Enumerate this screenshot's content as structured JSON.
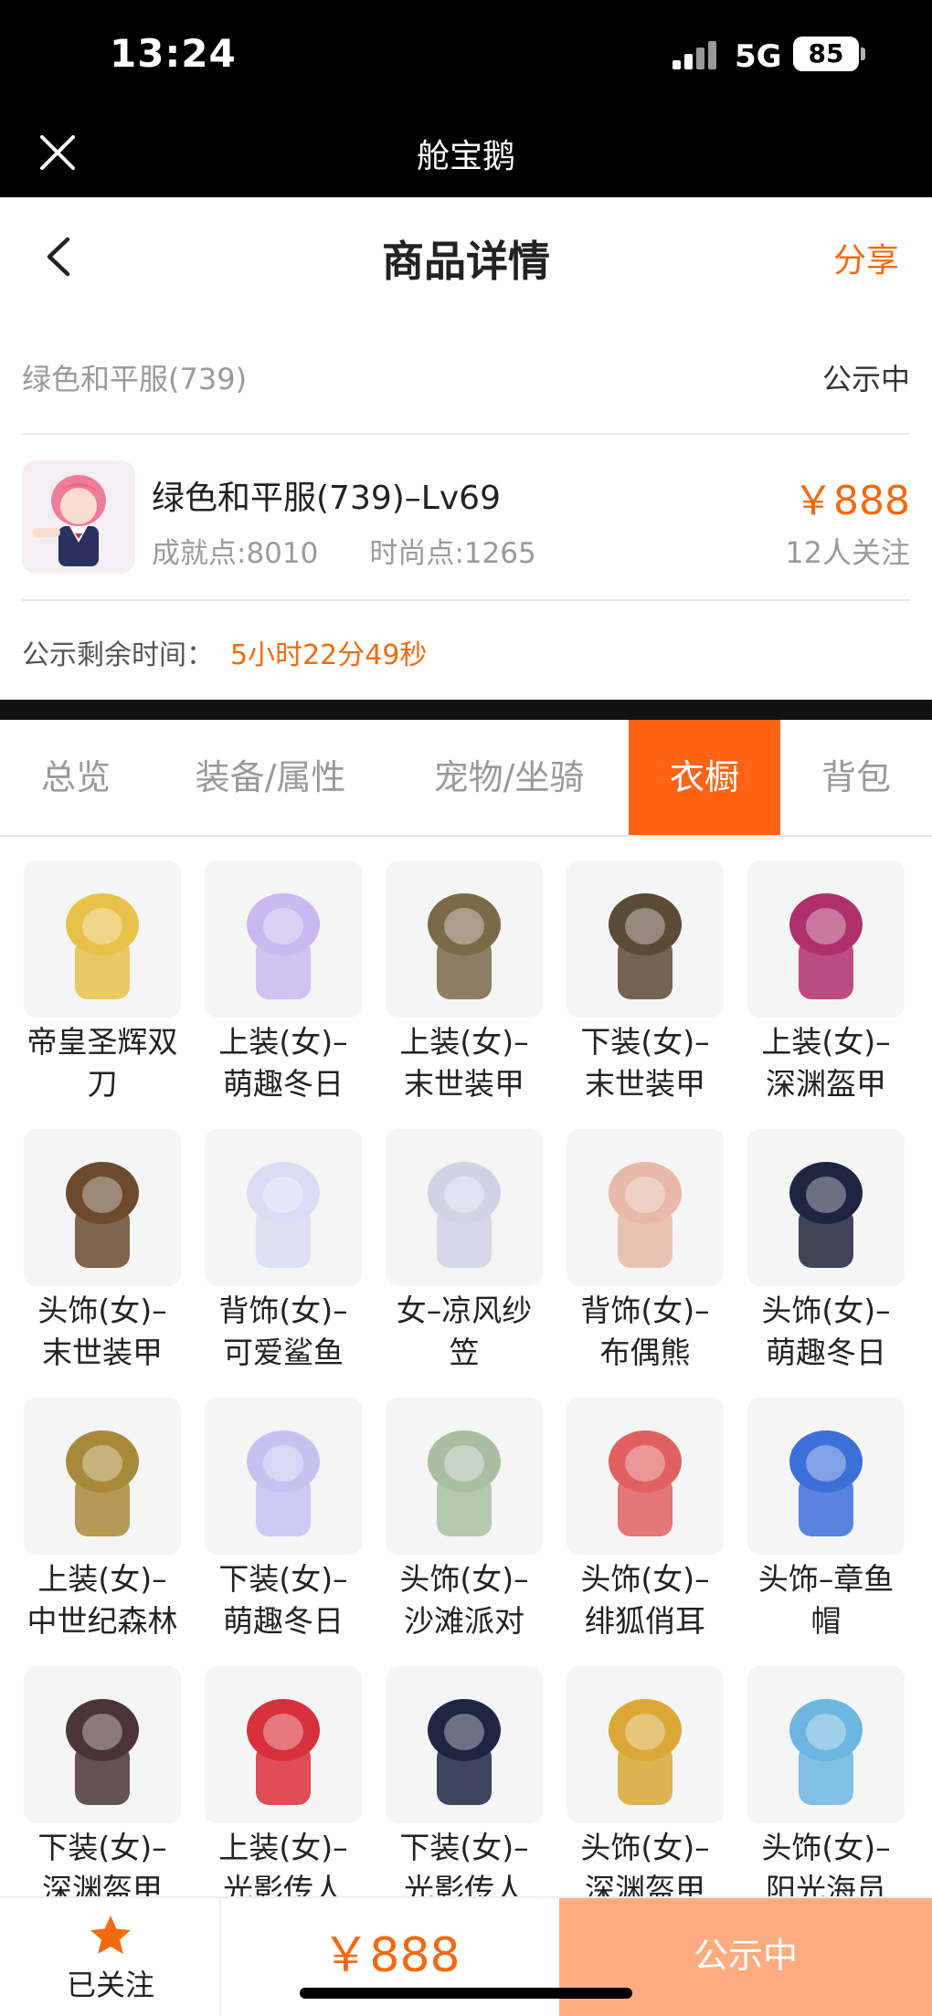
{
  "status_bar": {
    "time": "13:24",
    "network": "5G",
    "battery": "85"
  },
  "app_bar": {
    "title": "舱宝鹅"
  },
  "nav": {
    "title": "商品详情",
    "share": "分享"
  },
  "item": {
    "name": "绿色和平服(739)",
    "status": "公示中",
    "title": "绿色和平服(739)–Lv69",
    "achievement": "成就点:8010",
    "fashion": "时尚点:1265",
    "price": "￥888",
    "followers": "12人关注"
  },
  "timer": {
    "label": "公示剩余时间：",
    "value": "5小时22分49秒"
  },
  "tabs": [
    "总览",
    "装备/属性",
    "宠物/坐骑",
    "衣橱",
    "背包"
  ],
  "active_tab": "衣橱",
  "wardrobe": [
    {
      "line1": "帝皇圣辉双",
      "line2": "刀",
      "icon": "dual-blades-icon",
      "color": "#e8c14a"
    },
    {
      "line1": "上装(女)–",
      "line2": "萌趣冬日",
      "icon": "winter-top-icon",
      "color": "#c9b9f0"
    },
    {
      "line1": "上装(女)–",
      "line2": "末世装甲",
      "icon": "armor-top-icon",
      "color": "#7a6a4a"
    },
    {
      "line1": "下装(女)–",
      "line2": "末世装甲",
      "icon": "armor-legs-icon",
      "color": "#5a4a36"
    },
    {
      "line1": "上装(女)–",
      "line2": "深渊盔甲",
      "icon": "abyss-top-icon",
      "color": "#b0306a"
    },
    {
      "line1": "头饰(女)–",
      "line2": "末世装甲",
      "icon": "armor-helmet-icon",
      "color": "#6b4a2e"
    },
    {
      "line1": "背饰(女)–",
      "line2": "可爱鲨鱼",
      "icon": "shark-icon",
      "color": "#d8dcf5"
    },
    {
      "line1": "女–凉风纱",
      "line2": "笠",
      "icon": "veil-hat-icon",
      "color": "#cfd3e6"
    },
    {
      "line1": "背饰(女)–",
      "line2": "布偶熊",
      "icon": "teddy-bear-icon",
      "color": "#e8b8a8"
    },
    {
      "line1": "头饰(女)–",
      "line2": "萌趣冬日",
      "icon": "winter-hair-icon",
      "color": "#1e2540"
    },
    {
      "line1": "上装(女)–",
      "line2": "中世纪森林",
      "icon": "forest-top-icon",
      "color": "#a8893a"
    },
    {
      "line1": "下装(女)–",
      "line2": "萌趣冬日",
      "icon": "winter-boots-icon",
      "color": "#c6c2f0"
    },
    {
      "line1": "头饰(女)–",
      "line2": "沙滩派对",
      "icon": "beach-hat-icon",
      "color": "#a7bfa0"
    },
    {
      "line1": "头饰(女)–",
      "line2": "绯狐俏耳",
      "icon": "fox-ears-icon",
      "color": "#e06060"
    },
    {
      "line1": "头饰–章鱼",
      "line2": "帽",
      "icon": "octopus-hat-icon",
      "color": "#3d6fd8"
    },
    {
      "line1": "下装(女)–",
      "line2": "深渊盔甲",
      "icon": "abyss-boots-icon",
      "color": "#4a3436"
    },
    {
      "line1": "上装(女)–",
      "line2": "光影传人",
      "icon": "red-jacket-icon",
      "color": "#d8303a"
    },
    {
      "line1": "下装(女)–",
      "line2": "光影传人",
      "icon": "skirt-icon",
      "color": "#1f2644"
    },
    {
      "line1": "头饰(女)–",
      "line2": "深渊盔甲",
      "icon": "abyss-headband-icon",
      "color": "#d9a836"
    },
    {
      "line1": "头饰(女)–",
      "line2": "阳光海员",
      "icon": "sailor-hair-icon",
      "color": "#6cb6e0"
    }
  ],
  "bottom": {
    "follow_label": "已关注",
    "price": "￥888",
    "cta": "公示中"
  },
  "colors": {
    "accent": "#f26a10",
    "tab_active": "#ff6414",
    "cta_bg": "#fcac80"
  }
}
